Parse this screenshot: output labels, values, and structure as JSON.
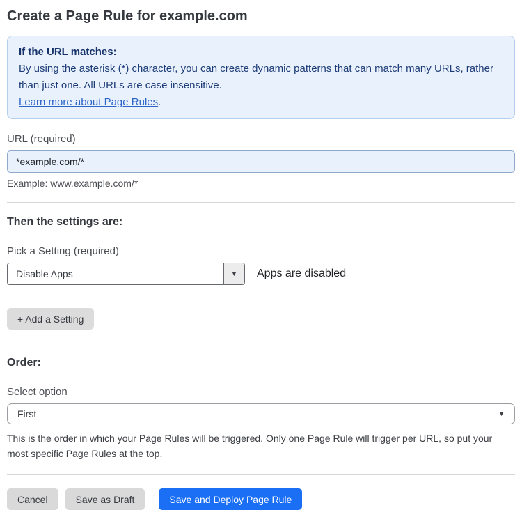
{
  "page": {
    "title": "Create a Page Rule for example.com"
  },
  "info_box": {
    "heading": "If the URL matches:",
    "body": "By using the asterisk (*) character, you can create dynamic patterns that can match many URLs, rather than just one. All URLs are case insensitive.",
    "link_label": "Learn more about Page Rules",
    "link_suffix": "."
  },
  "url_field": {
    "label": "URL (required)",
    "value": "*example.com/*",
    "example": "Example: www.example.com/*"
  },
  "settings_section": {
    "heading": "Then the settings are:",
    "pick_label": "Pick a Setting (required)",
    "selected_setting": "Disable Apps",
    "status_text": "Apps are disabled",
    "add_button_label": "+ Add a Setting"
  },
  "order_section": {
    "heading": "Order:",
    "label": "Select option",
    "selected_option": "First",
    "help_text": "This is the order in which your Page Rules will be triggered. Only one Page Rule will trigger per URL, so put your most specific Page Rules at the top."
  },
  "footer": {
    "cancel_label": "Cancel",
    "save_draft_label": "Save as Draft",
    "save_deploy_label": "Save and Deploy Page Rule"
  },
  "icons": {
    "caret_down": "▼"
  },
  "colors": {
    "info_bg": "#e9f2fc",
    "info_border": "#b3cfec",
    "info_text": "#1e3c78",
    "link": "#2b64c9",
    "input_bg": "#e9f1fc",
    "input_border": "#8fa9cb",
    "primary_button": "#1a6ff5",
    "gray_button": "#d9d9d9"
  }
}
